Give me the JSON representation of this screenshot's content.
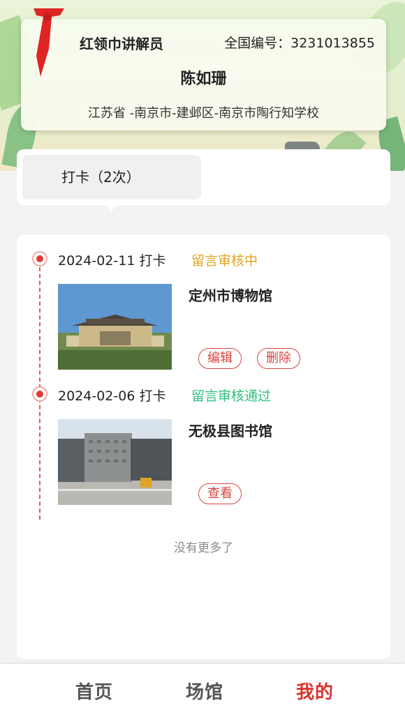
{
  "profile": {
    "role_title": "红领巾讲解员",
    "national_id": "全国编号：3231013855",
    "name": "陈如珊",
    "school": "江苏省 -南京市-建邺区-南京市陶行知学校"
  },
  "tabs": [
    {
      "label": "打卡（2次）",
      "active": true
    }
  ],
  "checkins": [
    {
      "date": "2024-02-11 打卡",
      "status": "留言审核中",
      "status_color": "#e0a526",
      "venue": "定州市博物馆",
      "actions": [
        "编辑",
        "删除"
      ]
    },
    {
      "date": "2024-02-06 打卡",
      "status": "留言审核通过",
      "status_color": "#2ec07a",
      "venue": "无极县图书馆",
      "actions": [
        "查看"
      ]
    }
  ],
  "no_more": "没有更多了",
  "bottom_nav": [
    {
      "label": "首页",
      "active": false
    },
    {
      "label": "场馆",
      "active": false
    },
    {
      "label": "我的",
      "active": true,
      "color": "#d9322c"
    }
  ]
}
